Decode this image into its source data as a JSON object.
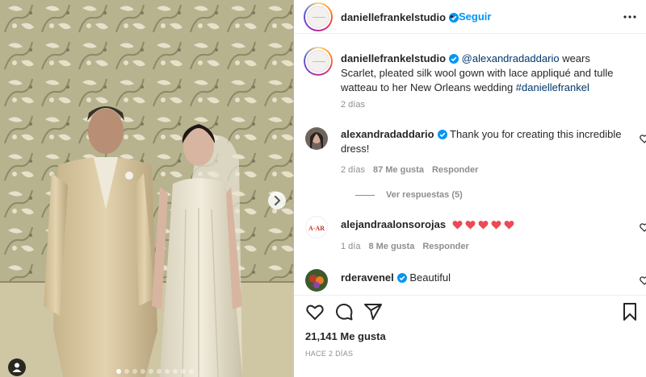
{
  "post": {
    "username": "daniellefrankelstudio",
    "follow_label": "Seguir",
    "separator": "•",
    "caption": {
      "username": "daniellefrankelstudio",
      "mention": "@alexandradaddario",
      "text": " wears Scarlet, pleated silk wool gown with lace appliqué and tulle watteau to her New Orleans wedding ",
      "hashtag": "#daniellefrankel",
      "time": "2 días"
    },
    "comments": [
      {
        "username": "alexandradaddario",
        "verified": true,
        "text": "Thank you for creating this incredible dress!",
        "time": "2 días",
        "likes": "87 Me gusta",
        "reply_label": "Responder",
        "replies_label": "Ver respuestas (5)"
      },
      {
        "username": "alejandraalonsorojas",
        "verified": false,
        "text": "",
        "emoji": "heart",
        "emoji_count": 5,
        "time": "1 día",
        "likes": "8 Me gusta",
        "reply_label": "Responder"
      },
      {
        "username": "rderavenel",
        "verified": true,
        "text": "Beautiful"
      }
    ],
    "likes_total": "21,141 Me gusta",
    "posted_ago": "HACE 2 DÍAS",
    "carousel": {
      "slide_count": 10,
      "active_index": 0
    }
  },
  "colors": {
    "link_blue": "#0095f6",
    "mention_blue": "#00376b",
    "verified_blue": "#0095f6",
    "muted": "#8e8e8e",
    "text": "#262626",
    "heart_red": "#ed4956"
  },
  "icons": [
    "verified-badge-icon",
    "more-options-icon",
    "heart-icon",
    "comment-icon",
    "share-icon",
    "bookmark-icon",
    "chevron-right-icon",
    "tag-person-icon"
  ]
}
